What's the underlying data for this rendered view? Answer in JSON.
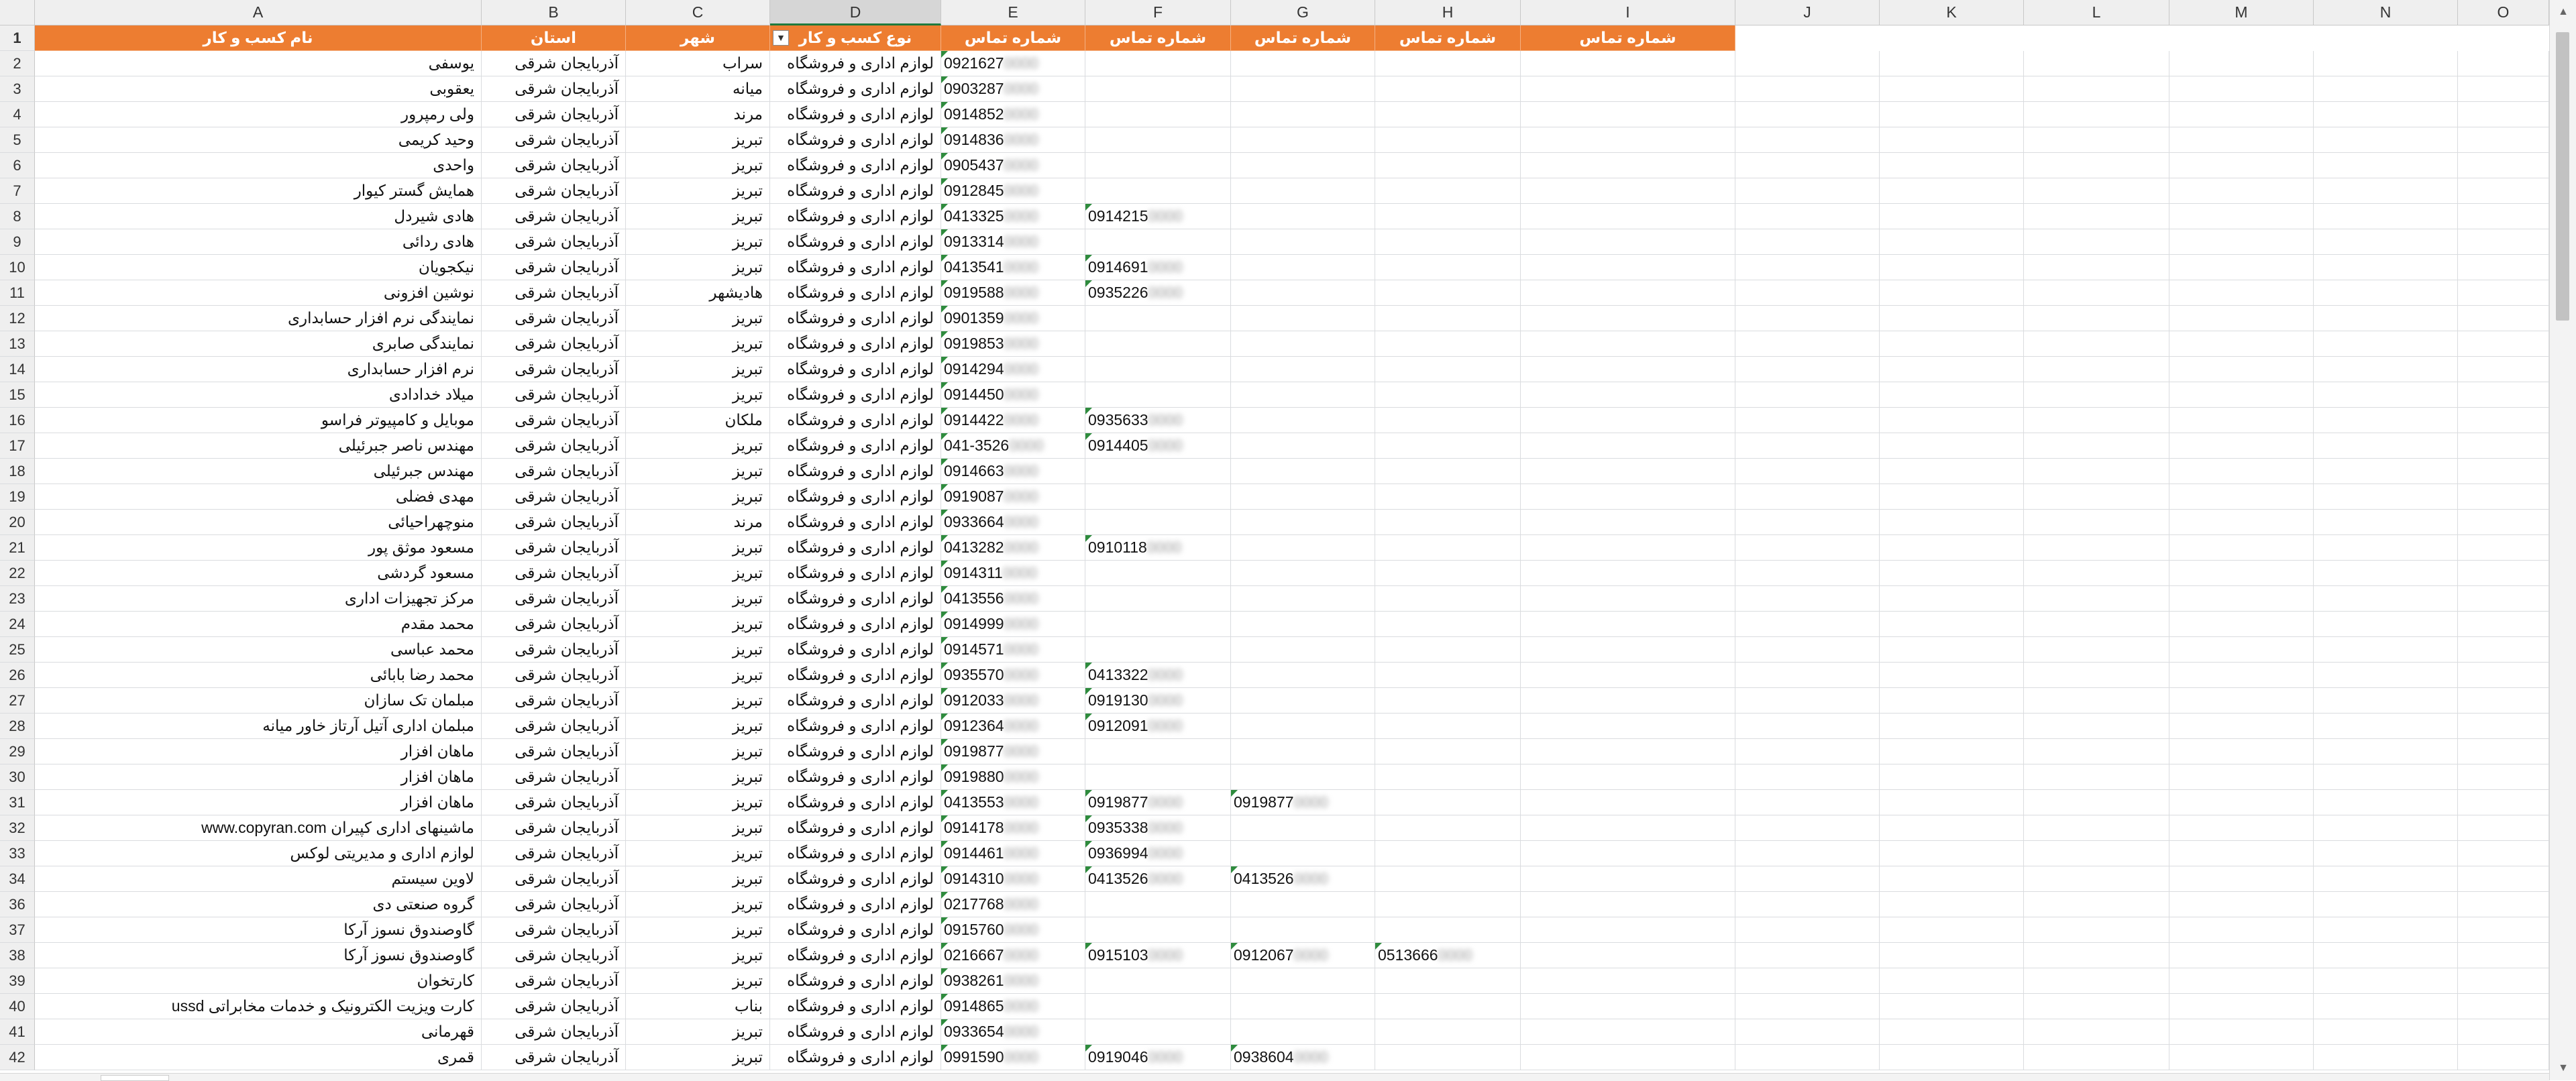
{
  "sheet": {
    "columns": [
      "A",
      "B",
      "C",
      "D",
      "E",
      "F",
      "G",
      "H",
      "I",
      "J",
      "K",
      "L",
      "M",
      "N",
      "O"
    ],
    "selected_column": "D",
    "accent_color": "#ed7d31",
    "headers": {
      "row_number": "1",
      "name": "نام کسب و کار",
      "province": "استان",
      "city": "شهر",
      "business_type": "نوع کسب و کار",
      "phone": "شماره تماس"
    },
    "rows": [
      {
        "n": "2",
        "name": "یوسفی",
        "prov": "آذربایجان شرقی",
        "city": "سراب",
        "type": "لوازم اداری و فروشگاه",
        "e": "0921627",
        "e_blur": "0000"
      },
      {
        "n": "3",
        "name": "یعقوبی",
        "prov": "آذربایجان شرقی",
        "city": "میانه",
        "type": "لوازم اداری و فروشگاه",
        "e": "0903287",
        "e_blur": "0000"
      },
      {
        "n": "4",
        "name": "ولی رمپرور",
        "prov": "آذربایجان شرقی",
        "city": "مرند",
        "type": "لوازم اداری و فروشگاه",
        "e": "0914852",
        "e_blur": "0000"
      },
      {
        "n": "5",
        "name": "وحید کریمی",
        "prov": "آذربایجان شرقی",
        "city": "تبریز",
        "type": "لوازم اداری و فروشگاه",
        "e": "0914836",
        "e_blur": "0000"
      },
      {
        "n": "6",
        "name": "واحدی",
        "prov": "آذربایجان شرقی",
        "city": "تبریز",
        "type": "لوازم اداری و فروشگاه",
        "e": "0905437",
        "e_blur": "0000"
      },
      {
        "n": "7",
        "name": "همایش گستر کیوار",
        "prov": "آذربایجان شرقی",
        "city": "تبریز",
        "type": "لوازم اداری و فروشگاه",
        "e": "0912845",
        "e_blur": "0000"
      },
      {
        "n": "8",
        "name": "هادی شیردل",
        "prov": "آذربایجان شرقی",
        "city": "تبریز",
        "type": "لوازم اداری و فروشگاه",
        "e": "0413325",
        "e_blur": "0000",
        "f": "0914215",
        "f_blur": "0000"
      },
      {
        "n": "9",
        "name": "هادی ردائی",
        "prov": "آذربایجان شرقی",
        "city": "تبریز",
        "type": "لوازم اداری و فروشگاه",
        "e": "0913314",
        "e_blur": "0000"
      },
      {
        "n": "10",
        "name": "نیکجویان",
        "prov": "آذربایجان شرقی",
        "city": "تبریز",
        "type": "لوازم اداری و فروشگاه",
        "e": "0413541",
        "e_blur": "0000",
        "f": "0914691",
        "f_blur": "0000"
      },
      {
        "n": "11",
        "name": "نوشین افزونی",
        "prov": "آذربایجان شرقی",
        "city": "هادیشهر",
        "type": "لوازم اداری و فروشگاه",
        "e": "0919588",
        "e_blur": "0000",
        "f": "0935226",
        "f_blur": "0000"
      },
      {
        "n": "12",
        "name": "نمایندگی نرم افزار حسابداری",
        "prov": "آذربایجان شرقی",
        "city": "تبریز",
        "type": "لوازم اداری و فروشگاه",
        "e": "0901359",
        "e_blur": "0000"
      },
      {
        "n": "13",
        "name": "نمایندگی صابری",
        "prov": "آذربایجان شرقی",
        "city": "تبریز",
        "type": "لوازم اداری و فروشگاه",
        "e": "0919853",
        "e_blur": "0000"
      },
      {
        "n": "14",
        "name": "نرم افزار حسابداری",
        "prov": "آذربایجان شرقی",
        "city": "تبریز",
        "type": "لوازم اداری و فروشگاه",
        "e": "0914294",
        "e_blur": "0000"
      },
      {
        "n": "15",
        "name": "میلاد خدادادی",
        "prov": "آذربایجان شرقی",
        "city": "تبریز",
        "type": "لوازم اداری و فروشگاه",
        "e": "0914450",
        "e_blur": "0000"
      },
      {
        "n": "16",
        "name": "موبایل و کامپیوتر فراسو",
        "prov": "آذربایجان شرقی",
        "city": "ملکان",
        "type": "لوازم اداری و فروشگاه",
        "e": "0914422",
        "e_blur": "0000",
        "f": "0935633",
        "f_blur": "0000"
      },
      {
        "n": "17",
        "name": "مهندس ناصر جبرئیلی",
        "prov": "آذربایجان شرقی",
        "city": "تبریز",
        "type": "لوازم اداری و فروشگاه",
        "e": "041-3526",
        "e_blur": "0000",
        "f": "0914405",
        "f_blur": "0000"
      },
      {
        "n": "18",
        "name": "مهندس جبرئیلی",
        "prov": "آذربایجان شرقی",
        "city": "تبریز",
        "type": "لوازم اداری و فروشگاه",
        "e": "0914663",
        "e_blur": "0000"
      },
      {
        "n": "19",
        "name": "مهدی فضلی",
        "prov": "آذربایجان شرقی",
        "city": "تبریز",
        "type": "لوازم اداری و فروشگاه",
        "e": "0919087",
        "e_blur": "0000"
      },
      {
        "n": "20",
        "name": "منوچهراحیائی",
        "prov": "آذربایجان شرقی",
        "city": "مرند",
        "type": "لوازم اداری و فروشگاه",
        "e": "0933664",
        "e_blur": "0000"
      },
      {
        "n": "21",
        "name": "مسعود موثق پور",
        "prov": "آذربایجان شرقی",
        "city": "تبریز",
        "type": "لوازم اداری و فروشگاه",
        "e": "0413282",
        "e_blur": "0000",
        "f": "0910118",
        "f_blur": "0000"
      },
      {
        "n": "22",
        "name": "مسعود گردشی",
        "prov": "آذربایجان شرقی",
        "city": "تبریز",
        "type": "لوازم اداری و فروشگاه",
        "e": "0914311",
        "e_blur": "0000"
      },
      {
        "n": "23",
        "name": "مرکز تجهیزات اداری",
        "prov": "آذربایجان شرقی",
        "city": "تبریز",
        "type": "لوازم اداری و فروشگاه",
        "e": "0413556",
        "e_blur": "0000"
      },
      {
        "n": "24",
        "name": "محمد مقدم",
        "prov": "آذربایجان شرقی",
        "city": "تبریز",
        "type": "لوازم اداری و فروشگاه",
        "e": "0914999",
        "e_blur": "0000"
      },
      {
        "n": "25",
        "name": "محمد عباسی",
        "prov": "آذربایجان شرقی",
        "city": "تبریز",
        "type": "لوازم اداری و فروشگاه",
        "e": "0914571",
        "e_blur": "0000"
      },
      {
        "n": "26",
        "name": "محمد رضا بابائی",
        "prov": "آذربایجان شرقی",
        "city": "تبریز",
        "type": "لوازم اداری و فروشگاه",
        "e": "0935570",
        "e_blur": "0000",
        "f": "0413322",
        "f_blur": "0000"
      },
      {
        "n": "27",
        "name": "مبلمان تک سازان",
        "prov": "آذربایجان شرقی",
        "city": "تبریز",
        "type": "لوازم اداری و فروشگاه",
        "e": "0912033",
        "e_blur": "0000",
        "f": "0919130",
        "f_blur": "0000"
      },
      {
        "n": "28",
        "name": "مبلمان اداری آتیل آرتاز خاور میانه",
        "prov": "آذربایجان شرقی",
        "city": "تبریز",
        "type": "لوازم اداری و فروشگاه",
        "e": "0912364",
        "e_blur": "0000",
        "f": "0912091",
        "f_blur": "0000"
      },
      {
        "n": "29",
        "name": "ماهان افزار",
        "prov": "آذربایجان شرقی",
        "city": "تبریز",
        "type": "لوازم اداری و فروشگاه",
        "e": "0919877",
        "e_blur": "0000"
      },
      {
        "n": "30",
        "name": "ماهان افزار",
        "prov": "آذربایجان شرقی",
        "city": "تبریز",
        "type": "لوازم اداری و فروشگاه",
        "e": "0919880",
        "e_blur": "0000"
      },
      {
        "n": "31",
        "name": "ماهان افزار",
        "prov": "آذربایجان شرقی",
        "city": "تبریز",
        "type": "لوازم اداری و فروشگاه",
        "e": "0413553",
        "e_blur": "0000",
        "f": "0919877",
        "f_blur": "0000",
        "g": "0919877",
        "g_blur": "0000"
      },
      {
        "n": "32",
        "name": "ماشینهای اداری کپیران www.copyran.com",
        "prov": "آذربایجان شرقی",
        "city": "تبریز",
        "type": "لوازم اداری و فروشگاه",
        "e": "0914178",
        "e_blur": "0000",
        "f": "0935338",
        "f_blur": "0000"
      },
      {
        "n": "33",
        "name": "لوازم اداری و مدیریتی لوکس",
        "prov": "آذربایجان شرقی",
        "city": "تبریز",
        "type": "لوازم اداری و فروشگاه",
        "e": "0914461",
        "e_blur": "0000",
        "f": "0936994",
        "f_blur": "0000"
      },
      {
        "n": "34",
        "name": "لاوین سیستم",
        "prov": "آذربایجان شرقی",
        "city": "تبریز",
        "type": "لوازم اداری و فروشگاه",
        "e": "0914310",
        "e_blur": "0000",
        "f": "0413526",
        "f_blur": "0000",
        "g": "0413526",
        "g_blur": "0000"
      },
      {
        "n": "36",
        "name": "گروه صنعتی دی",
        "prov": "آذربایجان شرقی",
        "city": "تبریز",
        "type": "لوازم اداری و فروشگاه",
        "e": "0217768",
        "e_blur": "0000"
      },
      {
        "n": "37",
        "name": "گاوصندوق نسوز آرکا",
        "prov": "آذربایجان شرقی",
        "city": "تبریز",
        "type": "لوازم اداری و فروشگاه",
        "e": "0915760",
        "e_blur": "0000"
      },
      {
        "n": "38",
        "name": "گاوصندوق نسوز آرکا",
        "prov": "آذربایجان شرقی",
        "city": "تبریز",
        "type": "لوازم اداری و فروشگاه",
        "e": "0216667",
        "e_blur": "0000",
        "f": "0915103",
        "f_blur": "0000",
        "g": "0912067",
        "g_blur": "0000",
        "h": "0513666",
        "h_blur": "0000"
      },
      {
        "n": "39",
        "name": "کارتخوان",
        "prov": "آذربایجان شرقی",
        "city": "تبریز",
        "type": "لوازم اداری و فروشگاه",
        "e": "0938261",
        "e_blur": "0000"
      },
      {
        "n": "40",
        "name": "کارت ویزیت الکترونیک و خدمات مخابراتی ussd",
        "prov": "آذربایجان شرقی",
        "city": "بناب",
        "type": "لوازم اداری و فروشگاه",
        "e": "0914865",
        "e_blur": "0000"
      },
      {
        "n": "41",
        "name": "قهرمانی",
        "prov": "آذربایجان شرقی",
        "city": "تبریز",
        "type": "لوازم اداری و فروشگاه",
        "e": "0933654",
        "e_blur": "0000"
      },
      {
        "n": "42",
        "name": "قمری",
        "prov": "آذربایجان شرقی",
        "city": "تبریز",
        "type": "لوازم اداری و فروشگاه",
        "e": "0991590",
        "e_blur": "0000",
        "f": "0919046",
        "f_blur": "0000",
        "g": "0938604",
        "g_blur": "0000"
      }
    ]
  }
}
